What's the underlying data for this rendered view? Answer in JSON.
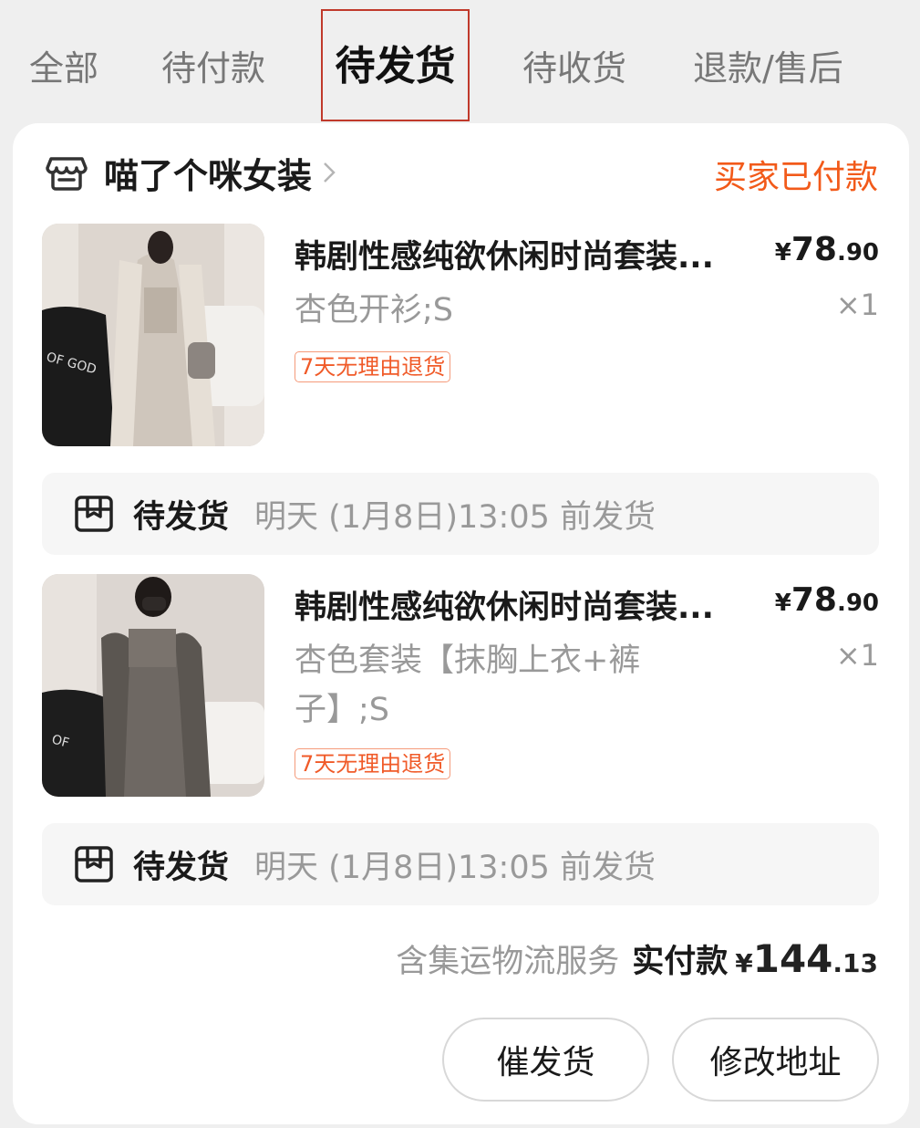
{
  "tabs": [
    {
      "label": "全部"
    },
    {
      "label": "待付款"
    },
    {
      "label": "待发货"
    },
    {
      "label": "待收货"
    },
    {
      "label": "退款/售后"
    }
  ],
  "active_tab": 2,
  "shop": {
    "icon": "store-icon",
    "name": "喵了个咪女装",
    "status": "买家已付款"
  },
  "items": [
    {
      "title": "韩剧性感纯欲休闲时尚套装...",
      "price_symbol": "¥",
      "price_int": "78",
      "price_dec": ".90",
      "spec": "杏色开衫;S",
      "qty": "×1",
      "badge": "7天无理由退货",
      "shipping": {
        "icon": "package-icon",
        "label": "待发货",
        "time": "明天 (1月8日)13:05 前发货"
      }
    },
    {
      "title": "韩剧性感纯欲休闲时尚套装...",
      "price_symbol": "¥",
      "price_int": "78",
      "price_dec": ".90",
      "spec": "杏色套装【抹胸上衣+裤子】;S",
      "qty": "×1",
      "badge": "7天无理由退货",
      "shipping": {
        "icon": "package-icon",
        "label": "待发货",
        "time": "明天 (1月8日)13:05 前发货"
      }
    }
  ],
  "summary": {
    "note": "含集运物流服务",
    "label": "实付款",
    "symbol": "¥",
    "int": "144",
    "dec": ".13"
  },
  "actions": {
    "remind": "催发货",
    "edit_address": "修改地址"
  },
  "colors": {
    "accent": "#f25a1a",
    "tab_highlight": "#c0392b"
  }
}
